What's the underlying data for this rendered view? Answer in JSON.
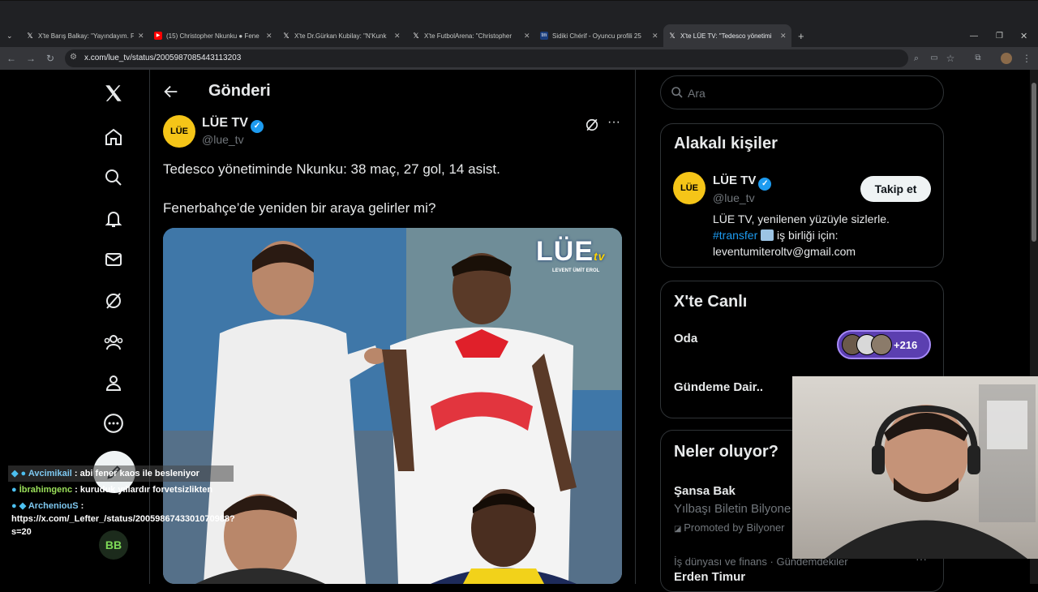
{
  "browser": {
    "tabs": [
      {
        "title": "X'te Barış Balkay: \"Yayındayım. F",
        "favicon": "x-icon"
      },
      {
        "title": "(15) Christopher Nkunku ● Fene",
        "favicon": "youtube-icon"
      },
      {
        "title": "X'te Dr.Gürkan Kubilay: \"N'Kunk",
        "favicon": "x-icon"
      },
      {
        "title": "X'te FutbolArena: \"Christopher",
        "favicon": "x-icon"
      },
      {
        "title": "Sidiki Chérif - Oyuncu profili 25",
        "favicon": "transfermarkt-icon"
      },
      {
        "title": "X'te LÜE TV: \"Tedesco yönetimi",
        "favicon": "x-icon"
      }
    ],
    "url": "x.com/lue_tv/status/2005987085443113203"
  },
  "post": {
    "header_title": "Gönderi",
    "author_name": "LÜE TV",
    "author_handle": "@lue_tv",
    "avatar_text": "LÜE",
    "line1": "Tedesco yönetiminde Nkunku: 38 maç, 27 gol, 14 asist.",
    "line2": "Fenerbahçe’de yeniden bir araya gelirler mi?",
    "image_logo": "LÜE",
    "image_logo_sub": "tv",
    "image_logo_caption": "LEVENT ÜMİT EROL"
  },
  "sidebar": {
    "search_placeholder": "Ara",
    "related": {
      "title": "Alakalı kişiler",
      "name": "LÜE TV",
      "handle": "@lue_tv",
      "follow_label": "Takip et",
      "bio_line1": "LÜE TV, yenilenen yüzüyle sizlerle.",
      "bio_hashtag": "#transfer",
      "bio_line2_rest": " iş birliği için:",
      "bio_line3": "leventumiteroltv@gmail.com"
    },
    "live": {
      "title": "X'te Canlı",
      "room_label": "Oda",
      "count": "+216",
      "topic": "Gündeme Dair.."
    },
    "trends": {
      "title": "Neler oluyor?",
      "item1_title": "Şansa Bak",
      "item1_sub": "Yılbaşı Biletin Bilyone",
      "item1_promo": "Promoted by Bilyoner",
      "item2_context": "İş dünyası ve finans · Gündemdekiler",
      "item2_title": "Erden Timur"
    }
  },
  "chat": [
    {
      "user": "Avcimikail",
      "text": " : abi fener kaos ile besleniyor",
      "color": "#7ec8f0"
    },
    {
      "user": "İbrahimgenc",
      "text": " : kuruduk yıllardır forvetsizlikten",
      "color": "#9be05a"
    },
    {
      "user": "ArcheniouS",
      "text": " :",
      "color": "#7ec8f0"
    }
  ],
  "chat_link": "https://x.com/_Lefter_/status/2005986743301070988?s=20",
  "colors": {
    "accent": "#1d9bf0",
    "background": "#000000",
    "text": "#e7e9ea",
    "muted": "#71767b"
  }
}
